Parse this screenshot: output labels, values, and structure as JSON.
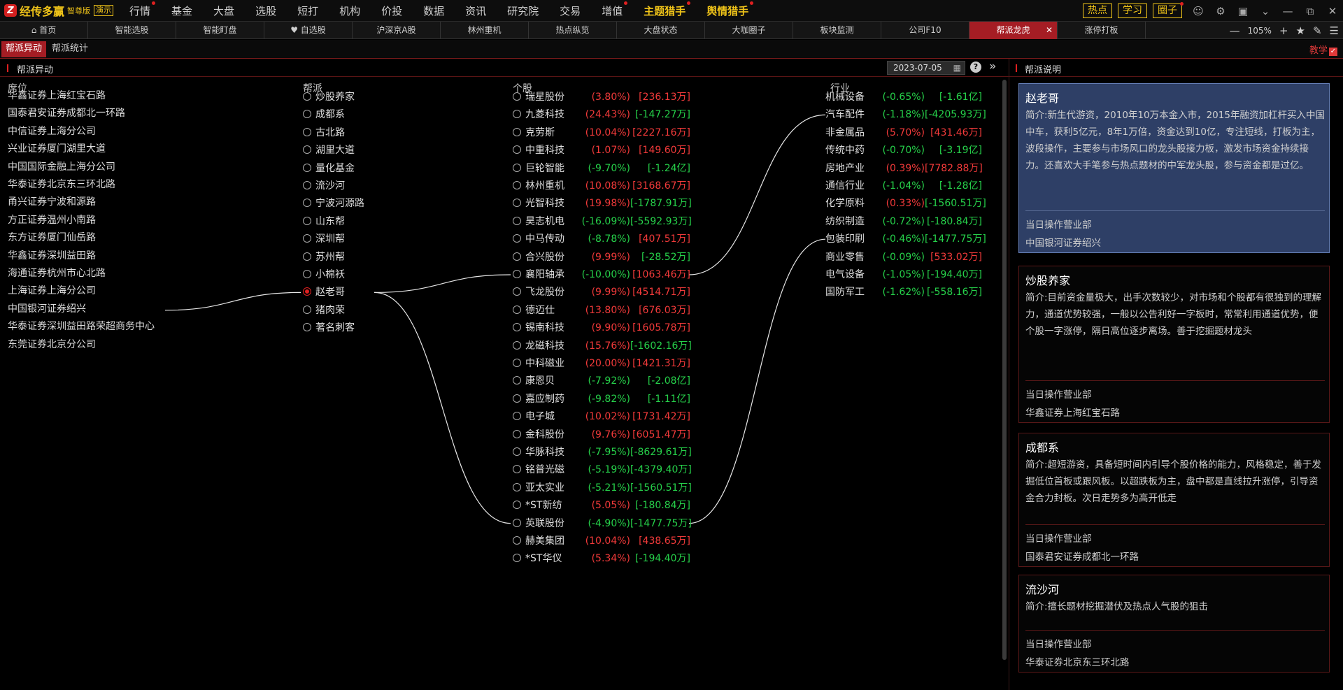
{
  "app": {
    "name": "经传多赢",
    "edition": "智尊版",
    "demo": "演示"
  },
  "menu": [
    {
      "label": "行情",
      "dot": true
    },
    {
      "label": "基金"
    },
    {
      "label": "大盘"
    },
    {
      "label": "选股"
    },
    {
      "label": "短打"
    },
    {
      "label": "机构"
    },
    {
      "label": "价投"
    },
    {
      "label": "数据"
    },
    {
      "label": "资讯"
    },
    {
      "label": "研究院"
    },
    {
      "label": "交易"
    },
    {
      "label": "增值",
      "dot": true
    },
    {
      "label": "主题猎手",
      "dot": true,
      "hl": true
    },
    {
      "label": "舆情猎手",
      "dot": true,
      "hl": true
    }
  ],
  "top_buttons": [
    {
      "label": "热点"
    },
    {
      "label": "学习"
    },
    {
      "label": "圈子",
      "dot": true
    }
  ],
  "tabs": [
    "首页",
    "智能选股",
    "智能盯盘",
    "自选股",
    "沪深京A股",
    "林州重机",
    "热点纵览",
    "大盘状态",
    "大咖圈子",
    "板块监测",
    "公司F10",
    "帮派龙虎",
    "涨停打板"
  ],
  "active_tab": "帮派龙虎",
  "zoom": "105%",
  "subtabs": [
    "帮派异动",
    "帮派统计"
  ],
  "teach_label": "教学",
  "left": {
    "title": "帮派异动",
    "date": "2023-07-05",
    "headers": {
      "seat": "席位",
      "gang": "帮派",
      "stock": "个股",
      "industry": "行业"
    }
  },
  "seats": [
    "华鑫证券上海红宝石路",
    "国泰君安证券成都北一环路",
    "中信证券上海分公司",
    "兴业证券厦门湖里大道",
    "中国国际金融上海分公司",
    "华泰证券北京东三环北路",
    "甬兴证券宁波和源路",
    "方正证券温州小南路",
    "东方证券厦门仙岳路",
    "华鑫证券深圳益田路",
    "海通证券杭州市心北路",
    "上海证券上海分公司",
    "中国银河证券绍兴",
    "华泰证券深圳益田路荣超商务中心",
    "东莞证券北京分公司"
  ],
  "gangs": [
    {
      "name": "炒股养家"
    },
    {
      "name": "成都系"
    },
    {
      "name": "古北路"
    },
    {
      "name": "湖里大道"
    },
    {
      "name": "量化基金"
    },
    {
      "name": "流沙河"
    },
    {
      "name": "宁波河源路"
    },
    {
      "name": "山东帮"
    },
    {
      "name": "深圳帮"
    },
    {
      "name": "苏州帮"
    },
    {
      "name": "小棉袄"
    },
    {
      "name": "赵老哥",
      "selected": true
    },
    {
      "name": "猪肉荣"
    },
    {
      "name": "著名刺客"
    }
  ],
  "stocks": [
    {
      "name": "瑞星股份",
      "pct": "(3.80%)",
      "amt": "[236.13万]",
      "pct_up": true,
      "amt_up": true
    },
    {
      "name": "九菱科技",
      "pct": "(24.43%)",
      "amt": "[-147.27万]",
      "pct_up": true,
      "amt_up": false
    },
    {
      "name": "克劳斯",
      "pct": "(10.04%)",
      "amt": "[2227.16万]",
      "pct_up": true,
      "amt_up": true
    },
    {
      "name": "中重科技",
      "pct": "(1.07%)",
      "amt": "[149.60万]",
      "pct_up": true,
      "amt_up": true
    },
    {
      "name": "巨轮智能",
      "pct": "(-9.70%)",
      "amt": "[-1.24亿]",
      "pct_up": false,
      "amt_up": false
    },
    {
      "name": "林州重机",
      "pct": "(10.08%)",
      "amt": "[3168.67万]",
      "pct_up": true,
      "amt_up": true
    },
    {
      "name": "光智科技",
      "pct": "(19.98%)",
      "amt": "[-1787.91万]",
      "pct_up": true,
      "amt_up": false
    },
    {
      "name": "昊志机电",
      "pct": "(-16.09%)",
      "amt": "[-5592.93万]",
      "pct_up": false,
      "amt_up": false
    },
    {
      "name": "中马传动",
      "pct": "(-8.78%)",
      "amt": "[407.51万]",
      "pct_up": false,
      "amt_up": true
    },
    {
      "name": "合兴股份",
      "pct": "(9.99%)",
      "amt": "[-28.52万]",
      "pct_up": true,
      "amt_up": false
    },
    {
      "name": "襄阳轴承",
      "pct": "(-10.00%)",
      "amt": "[1063.46万]",
      "pct_up": false,
      "amt_up": true
    },
    {
      "name": "飞龙股份",
      "pct": "(9.99%)",
      "amt": "[4514.71万]",
      "pct_up": true,
      "amt_up": true
    },
    {
      "name": "德迈仕",
      "pct": "(13.80%)",
      "amt": "[676.03万]",
      "pct_up": true,
      "amt_up": true
    },
    {
      "name": "锡南科技",
      "pct": "(9.90%)",
      "amt": "[1605.78万]",
      "pct_up": true,
      "amt_up": true
    },
    {
      "name": "龙磁科技",
      "pct": "(15.76%)",
      "amt": "[-1602.16万]",
      "pct_up": true,
      "amt_up": false
    },
    {
      "name": "中科磁业",
      "pct": "(20.00%)",
      "amt": "[1421.31万]",
      "pct_up": true,
      "amt_up": true
    },
    {
      "name": "康恩贝",
      "pct": "(-7.92%)",
      "amt": "[-2.08亿]",
      "pct_up": false,
      "amt_up": false
    },
    {
      "name": "嘉应制药",
      "pct": "(-9.82%)",
      "amt": "[-1.11亿]",
      "pct_up": false,
      "amt_up": false
    },
    {
      "name": "电子城",
      "pct": "(10.02%)",
      "amt": "[1731.42万]",
      "pct_up": true,
      "amt_up": true
    },
    {
      "name": "金科股份",
      "pct": "(9.76%)",
      "amt": "[6051.47万]",
      "pct_up": true,
      "amt_up": true
    },
    {
      "name": "华脉科技",
      "pct": "(-7.95%)",
      "amt": "[-8629.61万]",
      "pct_up": false,
      "amt_up": false
    },
    {
      "name": "铭普光磁",
      "pct": "(-5.19%)",
      "amt": "[-4379.40万]",
      "pct_up": false,
      "amt_up": false
    },
    {
      "name": "亚太实业",
      "pct": "(-5.21%)",
      "amt": "[-1560.51万]",
      "pct_up": false,
      "amt_up": false
    },
    {
      "name": "*ST新纺",
      "pct": "(5.05%)",
      "amt": "[-180.84万]",
      "pct_up": true,
      "amt_up": false
    },
    {
      "name": "英联股份",
      "pct": "(-4.90%)",
      "amt": "[-1477.75万]",
      "pct_up": false,
      "amt_up": false
    },
    {
      "name": "赫美集团",
      "pct": "(10.04%)",
      "amt": "[438.65万]",
      "pct_up": true,
      "amt_up": true
    },
    {
      "name": "*ST华仪",
      "pct": "(5.34%)",
      "amt": "[-194.40万]",
      "pct_up": true,
      "amt_up": false
    }
  ],
  "industries": [
    {
      "name": "机械设备",
      "pct": "(-0.65%)",
      "amt": "[-1.61亿]",
      "pct_up": false,
      "amt_up": false
    },
    {
      "name": "汽车配件",
      "pct": "(-1.18%)",
      "amt": "[-4205.93万]",
      "pct_up": false,
      "amt_up": false
    },
    {
      "name": "非金属品",
      "pct": "(5.70%)",
      "amt": "[431.46万]",
      "pct_up": true,
      "amt_up": true
    },
    {
      "name": "传统中药",
      "pct": "(-0.70%)",
      "amt": "[-3.19亿]",
      "pct_up": false,
      "amt_up": false
    },
    {
      "name": "房地产业",
      "pct": "(0.39%)",
      "amt": "[7782.88万]",
      "pct_up": true,
      "amt_up": true
    },
    {
      "name": "通信行业",
      "pct": "(-1.04%)",
      "amt": "[-1.28亿]",
      "pct_up": false,
      "amt_up": false
    },
    {
      "name": "化学原料",
      "pct": "(0.33%)",
      "amt": "[-1560.51万]",
      "pct_up": true,
      "amt_up": false
    },
    {
      "name": "纺织制造",
      "pct": "(-0.72%)",
      "amt": "[-180.84万]",
      "pct_up": false,
      "amt_up": false
    },
    {
      "name": "包装印刷",
      "pct": "(-0.46%)",
      "amt": "[-1477.75万]",
      "pct_up": false,
      "amt_up": false
    },
    {
      "name": "商业零售",
      "pct": "(-0.09%)",
      "amt": "[533.02万]",
      "pct_up": false,
      "amt_up": true
    },
    {
      "name": "电气设备",
      "pct": "(-1.05%)",
      "amt": "[-194.40万]",
      "pct_up": false,
      "amt_up": false
    },
    {
      "name": "国防军工",
      "pct": "(-1.62%)",
      "amt": "[-558.16万]",
      "pct_up": false,
      "amt_up": false
    }
  ],
  "links": {
    "seat_to_gang": [
      [
        12,
        11
      ]
    ],
    "gang_to_stock": [
      [
        11,
        10
      ],
      [
        11,
        24
      ]
    ],
    "stock_to_industry": [
      [
        10,
        1
      ],
      [
        24,
        8
      ]
    ]
  },
  "right": {
    "title": "帮派说明",
    "op_label": "当日操作营业部",
    "cards": [
      {
        "name": "赵老哥",
        "desc": "简介:新生代游资，2010年10万本金入市，2015年融资加杠杆买入中国中车，获利5亿元，8年1万倍，资金达到10亿，专注短线，打板为主，波段操作，主要参与市场风口的龙头股接力板，激发市场资金持续接力。还喜欢大手笔参与热点题材的中军龙头股，参与资金都是过亿。",
        "office": "中国银河证券绍兴",
        "selected": true
      },
      {
        "name": "炒股养家",
        "desc": "简介:目前资金量极大，出手次数较少，对市场和个股都有很独到的理解力，通道优势较强，一般以公告利好一字板时，常常利用通道优势，便个股一字涨停，隔日高位逐步离场。善于挖掘题材龙头",
        "office": "华鑫证券上海红宝石路"
      },
      {
        "name": "成都系",
        "desc": "简介:超短游资，具备短时间内引导个股价格的能力，风格稳定，善于发掘低位首板或跟风板。以超跌板为主，盘中都是直线拉升涨停，引导资金合力封板。次日走势多为高开低走",
        "office": "国泰君安证券成都北一环路"
      },
      {
        "name": "流沙河",
        "desc": "简介:擅长题材挖掘潜伏及热点人气股的狙击",
        "office": "华泰证券北京东三环北路"
      }
    ]
  }
}
